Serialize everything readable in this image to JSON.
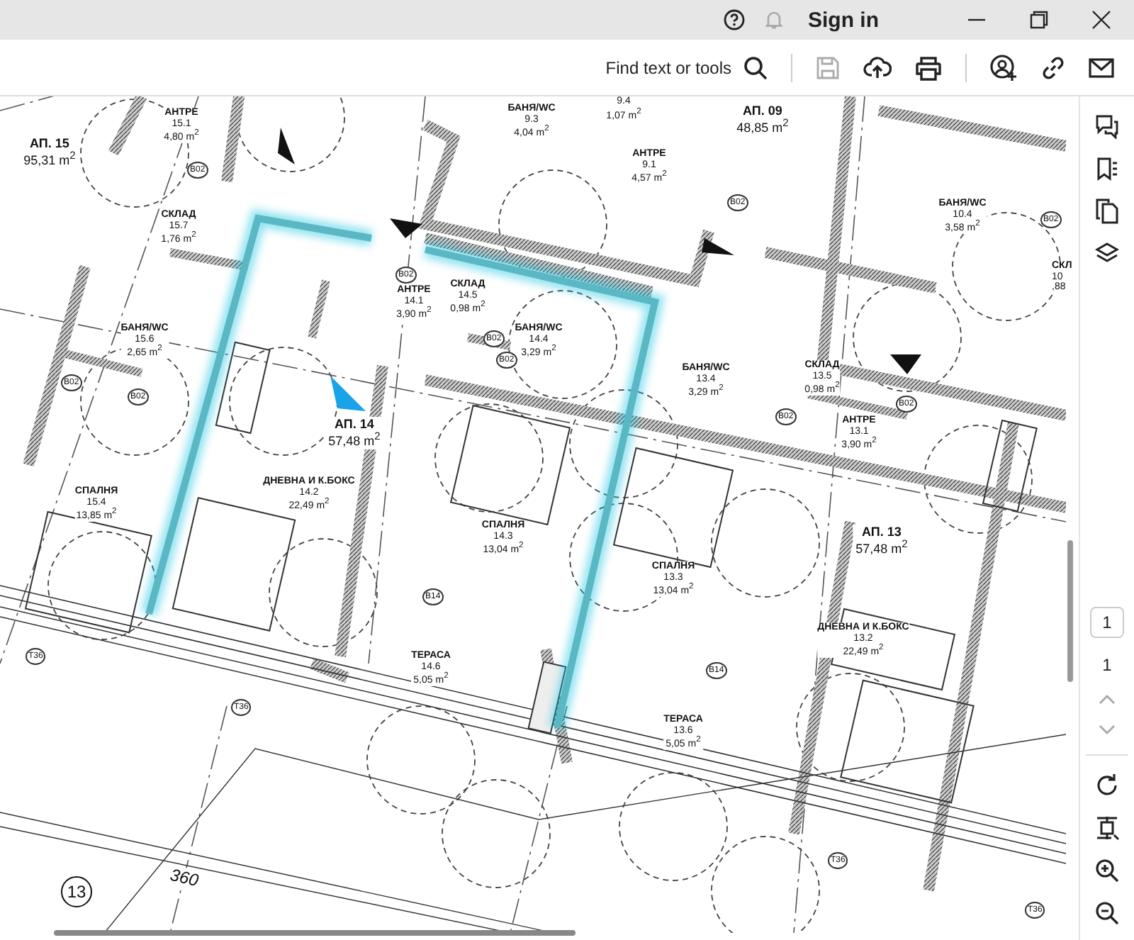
{
  "titlebar": {
    "sign_in": "Sign in"
  },
  "toolbar": {
    "search_label": "Find text or tools"
  },
  "plan": {
    "apartments": [
      {
        "name": "АП. 15",
        "area": "95,31 m$^{2}$"
      },
      {
        "name": "АП. 14",
        "area": "57,48 m$^{2}$"
      },
      {
        "name": "АП. 09",
        "area": "48,85 m$^{2}$"
      },
      {
        "name": "АП. 13",
        "area": "57,48 m$^{2}$"
      }
    ],
    "rooms": [
      {
        "name": "АНТРЕ",
        "number": "15.1",
        "area": "4,80 m$^{2}$"
      },
      {
        "name": "СКЛАД",
        "number": "15.7",
        "area": "1,76 m$^{2}$"
      },
      {
        "name": "БАНЯ/WC",
        "number": "15.6",
        "area": "2,65 m$^{2}$"
      },
      {
        "name": "СПАЛНЯ",
        "number": "15.4",
        "area": "13,85 m$^{2}$"
      },
      {
        "name": "АНТРЕ",
        "number": "14.1",
        "area": "3,90 m$^{2}$"
      },
      {
        "name": "СКЛАД",
        "number": "14.5",
        "area": "0,98 m$^{2}$"
      },
      {
        "name": "БАНЯ/WC",
        "number": "14.4",
        "area": "3,29 m$^{2}$"
      },
      {
        "name": "ДНЕВНА И К.БОКС",
        "number": "14.2",
        "area": "22,49 m$^{2}$"
      },
      {
        "name": "СПАЛНЯ",
        "number": "14.3",
        "area": "13,04 m$^{2}$"
      },
      {
        "name": "ТЕРАСА",
        "number": "14.6",
        "area": "5,05 m$^{2}$"
      },
      {
        "name": "БАНЯ/WC",
        "number": "9.3",
        "area": "4,04 m$^{2}$"
      },
      {
        "number": "9.4",
        "area": "1,07 m$^{2}$"
      },
      {
        "name": "АНТРЕ",
        "number": "9.1",
        "area": "4,57 m$^{2}$"
      },
      {
        "name": "БАНЯ/WC",
        "number": "10.4",
        "area": "3,58 m$^{2}$"
      },
      {
        "name": "СКЛ",
        "number": "10",
        "area": ",88"
      },
      {
        "name": "БАНЯ/WC",
        "number": "13.4",
        "area": "3,29 m$^{2}$"
      },
      {
        "name": "СКЛАД",
        "number": "13.5",
        "area": "0,98 m$^{2}$"
      },
      {
        "name": "АНТРЕ",
        "number": "13.1",
        "area": "3,90 m$^{2}$"
      },
      {
        "name": "СПАЛНЯ",
        "number": "13.3",
        "area": "13,04 m$^{2}$"
      },
      {
        "name": "ДНЕВНА И К.БОКС",
        "number": "13.2",
        "area": "22,49 m$^{2}$"
      },
      {
        "name": "ТЕРАСА",
        "number": "13.6",
        "area": "5,05 m$^{2}$"
      }
    ],
    "door_tags": [
      "B02",
      "B02",
      "B02",
      "B02",
      "B02",
      "B02",
      "B02",
      "B02",
      "B02",
      "B02",
      "B14",
      "B14",
      "T36",
      "T36",
      "T36",
      "T36"
    ],
    "dimension": "360",
    "grid_axis": "13"
  },
  "page_nav": {
    "page_field": "1",
    "page_count": "1"
  }
}
